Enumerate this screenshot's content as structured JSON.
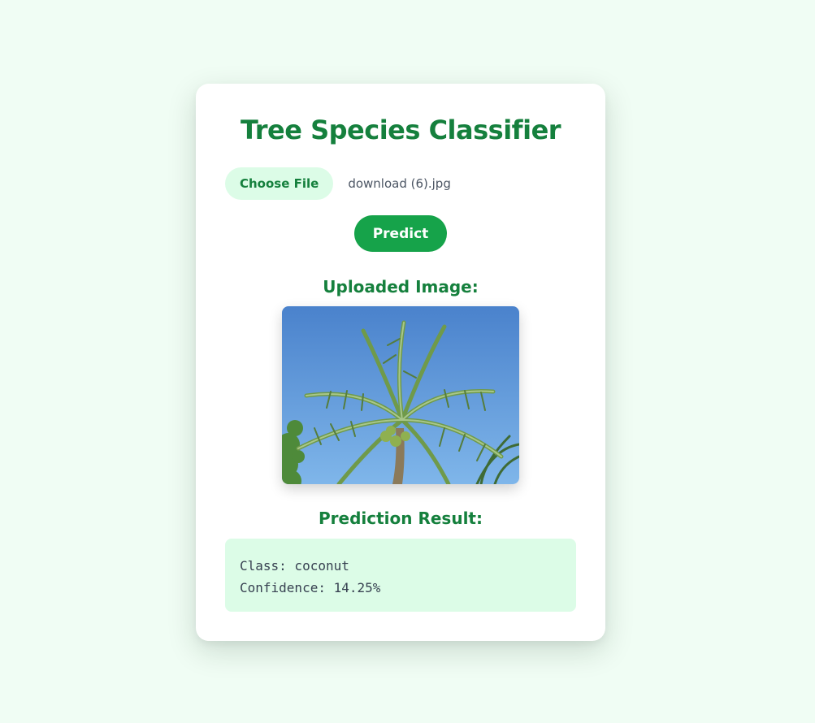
{
  "page": {
    "title": "Tree Species Classifier"
  },
  "upload": {
    "choose_label": "Choose File",
    "file_name": "download (6).jpg"
  },
  "actions": {
    "predict_label": "Predict"
  },
  "uploaded": {
    "heading": "Uploaded Image:"
  },
  "result": {
    "heading": "Prediction Result:",
    "class_line": "Class: coconut",
    "confidence_line": "Confidence: 14.25%"
  },
  "colors": {
    "background": "#f0fdf4",
    "accent": "#15803d",
    "button": "#16a34a",
    "light_accent": "#dcfce7"
  }
}
